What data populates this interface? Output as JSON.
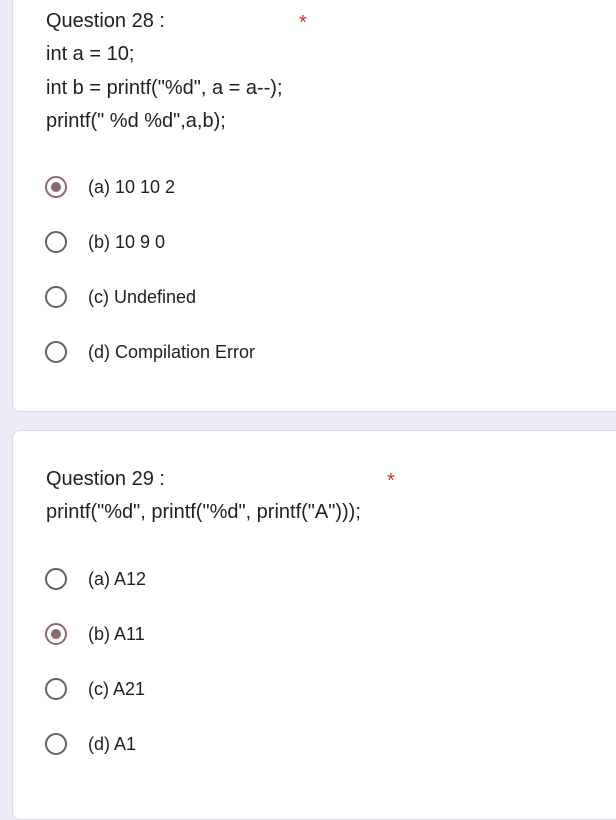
{
  "accent_color": "#8a6a6a",
  "required_color": "#d93025",
  "questions": [
    {
      "title": "Question 28 :",
      "required_mark": "*",
      "code": [
        "int a = 10;",
        "int b = printf(\"%d\", a = a--);",
        "printf(\" %d %d\",a,b);"
      ],
      "options": [
        {
          "label": "(a) 10 10 2",
          "selected": true
        },
        {
          "label": "(b) 10 9 0",
          "selected": false
        },
        {
          "label": "(c) Undefined",
          "selected": false
        },
        {
          "label": "(d) Compilation Error",
          "selected": false
        }
      ]
    },
    {
      "title": "Question 29 :",
      "required_mark": "*",
      "code": [
        "printf(\"%d\", printf(\"%d\", printf(\"A\")));"
      ],
      "options": [
        {
          "label": "(a) A12",
          "selected": false
        },
        {
          "label": "(b) A11",
          "selected": true
        },
        {
          "label": "(c) A21",
          "selected": false
        },
        {
          "label": "(d) A1",
          "selected": false
        }
      ]
    }
  ]
}
